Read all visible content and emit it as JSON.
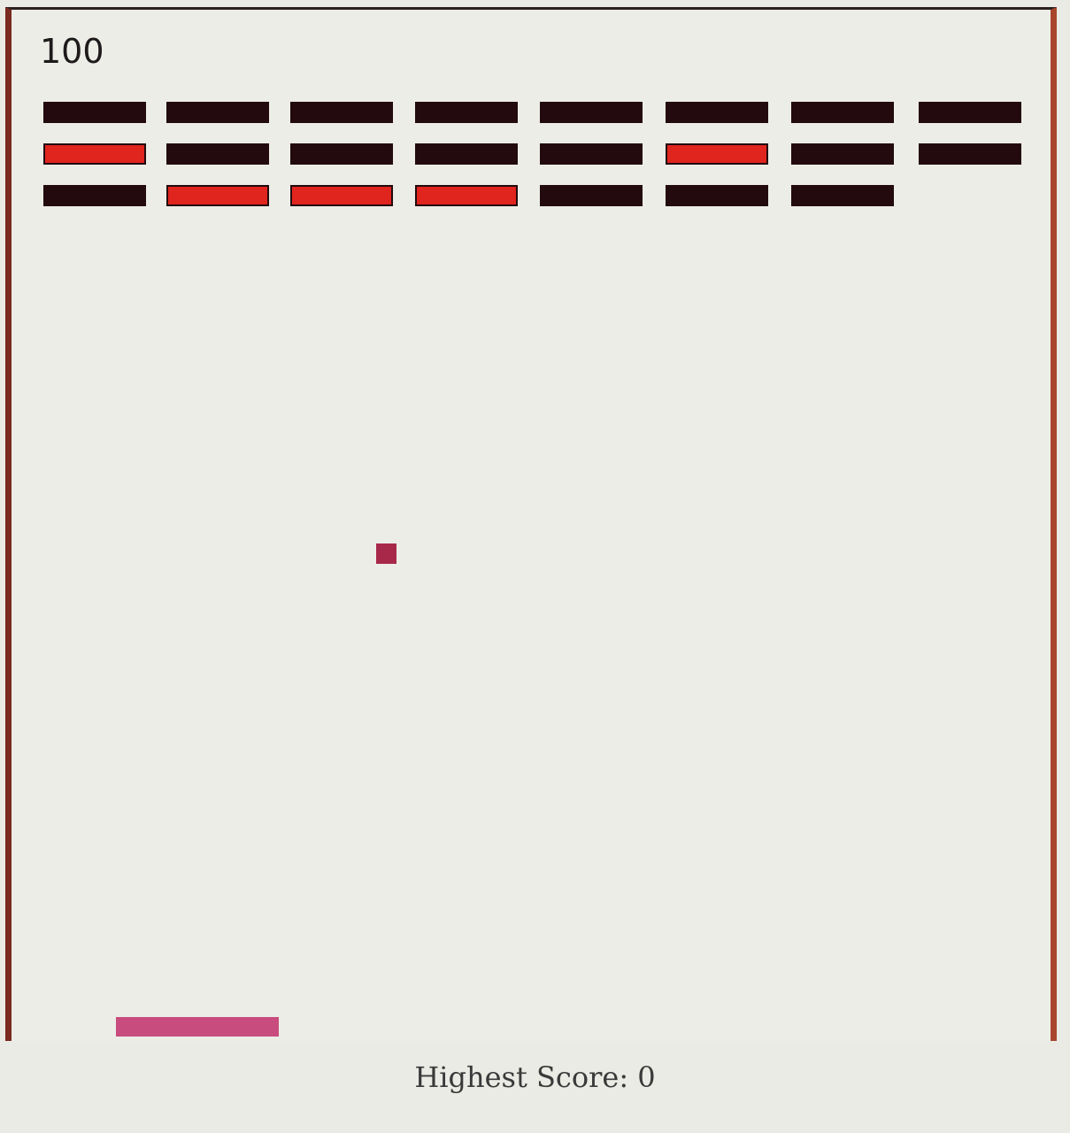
{
  "score": "100",
  "highest_score": "Highest Score: 0",
  "colors": {
    "brick_dark": "#220a0e",
    "brick_red": "#e0241e",
    "ball": "#a8284a",
    "paddle": "#c84c7e"
  },
  "bricks": [
    [
      "dark",
      "dark",
      "dark",
      "dark",
      "dark",
      "dark",
      "dark",
      "dark"
    ],
    [
      "red",
      "dark",
      "dark",
      "dark",
      "dark",
      "red",
      "dark",
      "dark"
    ],
    [
      "dark",
      "red",
      "red",
      "red",
      "dark",
      "dark",
      "dark",
      null
    ]
  ]
}
